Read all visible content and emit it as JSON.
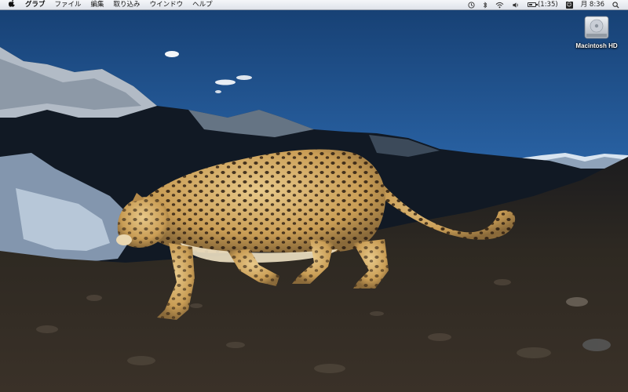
{
  "menubar": {
    "apple_icon": "apple-icon",
    "app_name": "グラブ",
    "items": [
      "ファイル",
      "編集",
      "取り込み",
      "ウインドウ",
      "ヘルプ"
    ],
    "status": {
      "battery_text": "(1:35)",
      "battery_level": 0.6,
      "clock": "月 8:36"
    },
    "status_icons": [
      "time-machine-icon",
      "bluetooth-icon",
      "wifi-icon",
      "volume-icon",
      "battery-icon",
      "user-icon",
      "spotlight-icon"
    ]
  },
  "desktop": {
    "icons": [
      {
        "label": "Macintosh HD",
        "icon": "hard-drive-icon"
      }
    ],
    "wallpaper": "snow-leopard-mountains"
  },
  "colors": {
    "sky_top": "#1c4f86",
    "sky_bottom": "#5b9be0",
    "ground": "#2a2620",
    "leopard": "#c9a05a"
  }
}
